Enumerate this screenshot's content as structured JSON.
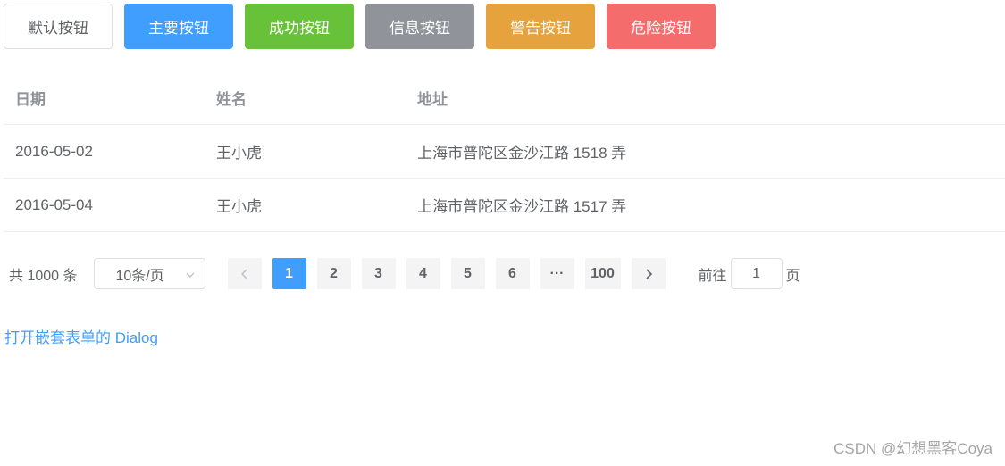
{
  "buttons": {
    "default": "默认按钮",
    "primary": "主要按钮",
    "success": "成功按钮",
    "info": "信息按钮",
    "warning": "警告按钮",
    "danger": "危险按钮"
  },
  "colors": {
    "primary": "#409eff",
    "success": "#67c23a",
    "info": "#909399",
    "warning": "#e6a23c",
    "danger": "#f56c6c"
  },
  "table": {
    "headers": [
      "日期",
      "姓名",
      "地址"
    ],
    "rows": [
      [
        "2016-05-02",
        "王小虎",
        "上海市普陀区金沙江路 1518 弄"
      ],
      [
        "2016-05-04",
        "王小虎",
        "上海市普陀区金沙江路 1517 弄"
      ]
    ]
  },
  "pagination": {
    "total": "共 1000 条",
    "page_size": "10条/页",
    "pages": [
      "1",
      "2",
      "3",
      "4",
      "5",
      "6",
      "···",
      "100"
    ],
    "current_page": "1",
    "goto_label": "前往",
    "goto_value": "1",
    "goto_suffix": "页",
    "prev_icon": "chevron-left-icon",
    "next_icon": "chevron-right-icon",
    "select_icon": "chevron-down-icon"
  },
  "dialog_link": "打开嵌套表单的 Dialog",
  "watermark": "CSDN @幻想黑客Coya"
}
